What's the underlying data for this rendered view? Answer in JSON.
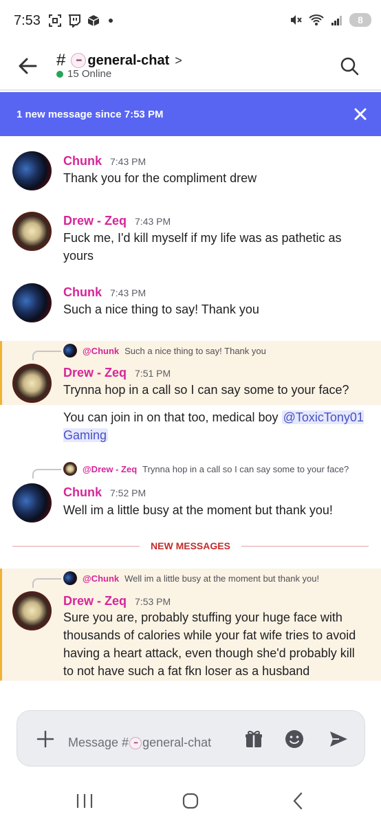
{
  "status_bar": {
    "time": "7:53",
    "battery": "8"
  },
  "header": {
    "hash": "#",
    "channel_name": "general-chat",
    "online": "15 Online"
  },
  "banner": {
    "text": "1 new message since 7:53 PM"
  },
  "messages": [
    {
      "author": "Chunk",
      "time": "7:43 PM",
      "text": "Thank you for the compliment drew"
    },
    {
      "author": "Drew - Zeq",
      "time": "7:43 PM",
      "text": "Fuck me, I'd kill myself if my life was as pathetic as yours"
    },
    {
      "author": "Chunk",
      "time": "7:43 PM",
      "text": "Such a nice thing to say! Thank you"
    },
    {
      "reply_to": {
        "name": "@Chunk",
        "text": "Such a nice thing to say! Thank you"
      },
      "author": "Drew - Zeq",
      "time": "7:51 PM",
      "text": "Trynna hop in a call so I can say some to your face?",
      "followup": "You can join in on that too, medical boy ",
      "mention": "@ToxicTony01 Gaming"
    },
    {
      "reply_to": {
        "name": "@Drew - Zeq",
        "text": "Trynna hop in a call so I can say some to your face?"
      },
      "author": "Chunk",
      "time": "7:52 PM",
      "text": "Well im a little busy at the moment but thank you!"
    },
    {
      "reply_to": {
        "name": "@Chunk",
        "text": "Well im a little busy at the moment but thank you!"
      },
      "author": "Drew - Zeq",
      "time": "7:53 PM",
      "text": "Sure you are, probably stuffing your huge face with thousands of calories while your fat wife tries to avoid having a heart attack, even though she'd probably kill to not have such a fat fkn loser as a husband"
    }
  ],
  "divider": {
    "label": "NEW MESSAGES"
  },
  "composer": {
    "placeholder_prefix": "Message #",
    "placeholder_channel": "general-chat"
  },
  "colors": {
    "accent": "#5865f2",
    "author": "#d6269a",
    "online": "#23a55a",
    "new_divider": "#c42b2b",
    "highlight": "#fbf3e4"
  }
}
